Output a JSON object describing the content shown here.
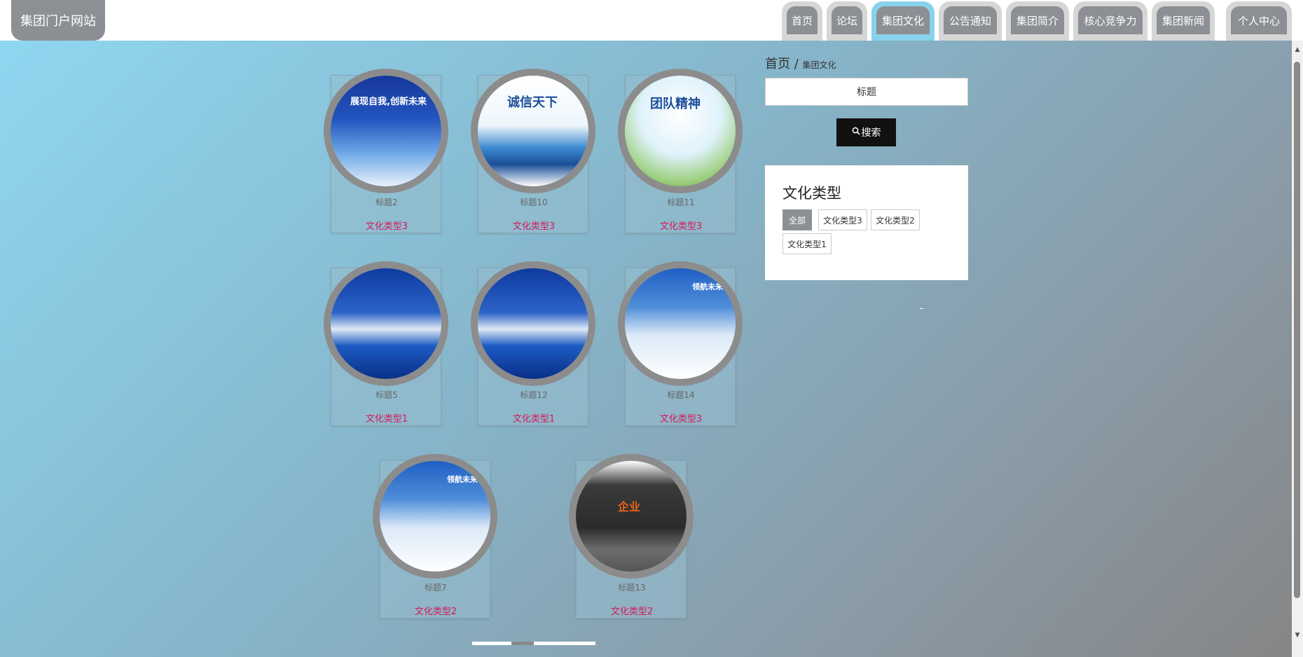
{
  "header": {
    "site_title": "集团门户网站",
    "nav": [
      "首页",
      "论坛",
      "集团文化",
      "公告通知",
      "集团简介",
      "核心竞争力",
      "集团新闻",
      "个人中心"
    ],
    "active_nav": "集团文化"
  },
  "breadcrumb": {
    "home": "首页",
    "separator": "/",
    "current": "集团文化"
  },
  "search": {
    "value": "标题",
    "button_label": "搜索"
  },
  "filter": {
    "title": "文化类型",
    "tags": [
      "全部",
      "文化类型3",
      "文化类型2",
      "文化类型1"
    ],
    "active": "全部"
  },
  "cards": [
    {
      "title": "标题2",
      "type": "文化类型3",
      "image_text": "展现自我,创新未来"
    },
    {
      "title": "标题10",
      "type": "文化类型3",
      "image_text": "诚信天下"
    },
    {
      "title": "标题11",
      "type": "文化类型3",
      "image_text": "团队精神"
    },
    {
      "title": "标题5",
      "type": "文化类型1",
      "image_text": ""
    },
    {
      "title": "标题12",
      "type": "文化类型1",
      "image_text": ""
    },
    {
      "title": "标题14",
      "type": "文化类型3",
      "image_text": "领航未来"
    },
    {
      "title": "标题7",
      "type": "文化类型2",
      "image_text": "领航未来"
    },
    {
      "title": "标题13",
      "type": "文化类型2",
      "image_text": "企业"
    }
  ]
}
